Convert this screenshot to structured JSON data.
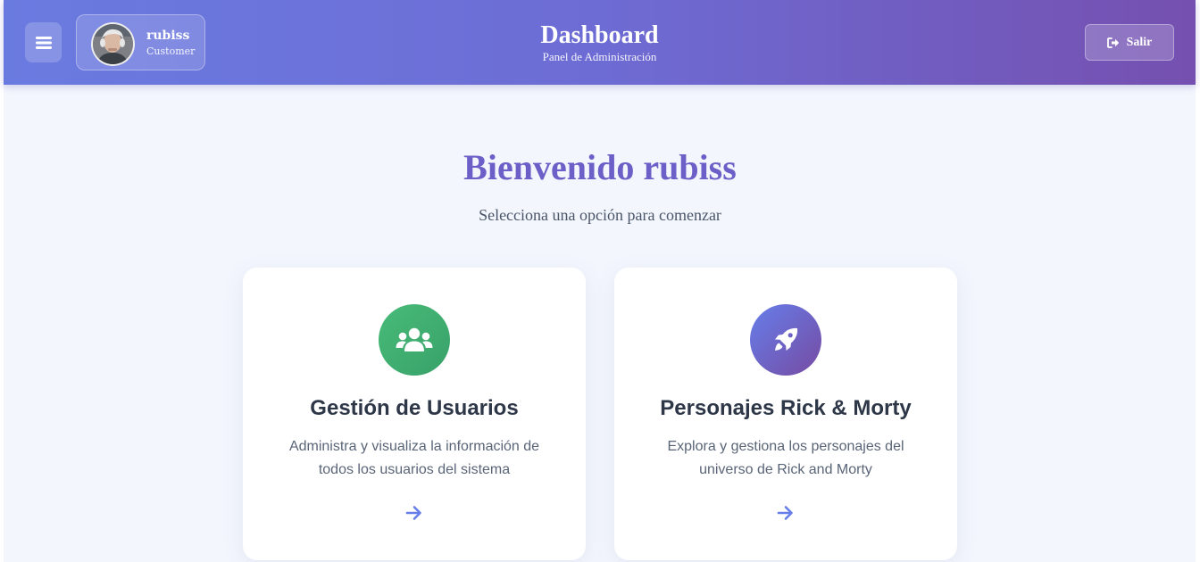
{
  "header": {
    "title": "Dashboard",
    "subtitle": "Panel de Administración",
    "menu_icon": "bars-icon",
    "user": {
      "name": "rubiss",
      "role": "Customer"
    },
    "logout_label": "Salir",
    "logout_icon": "sign-out-icon",
    "gradient": [
      "#6a7be0",
      "#7550b0"
    ]
  },
  "main": {
    "welcome": "Bienvenido rubiss",
    "subtitle": "Selecciona una opción para comenzar",
    "cards": [
      {
        "title": "Gestión de Usuarios",
        "description": "Administra y visualiza la información de todos los usuarios del sistema",
        "icon": "users-icon",
        "icon_color": "#48bb78"
      },
      {
        "title": "Personajes Rick & Morty",
        "description": "Explora y gestiona los personajes del universo de Rick and Morty",
        "icon": "rocket-icon",
        "icon_color": "#6a5fc7"
      }
    ],
    "accent_color": "#6c5fc7"
  }
}
